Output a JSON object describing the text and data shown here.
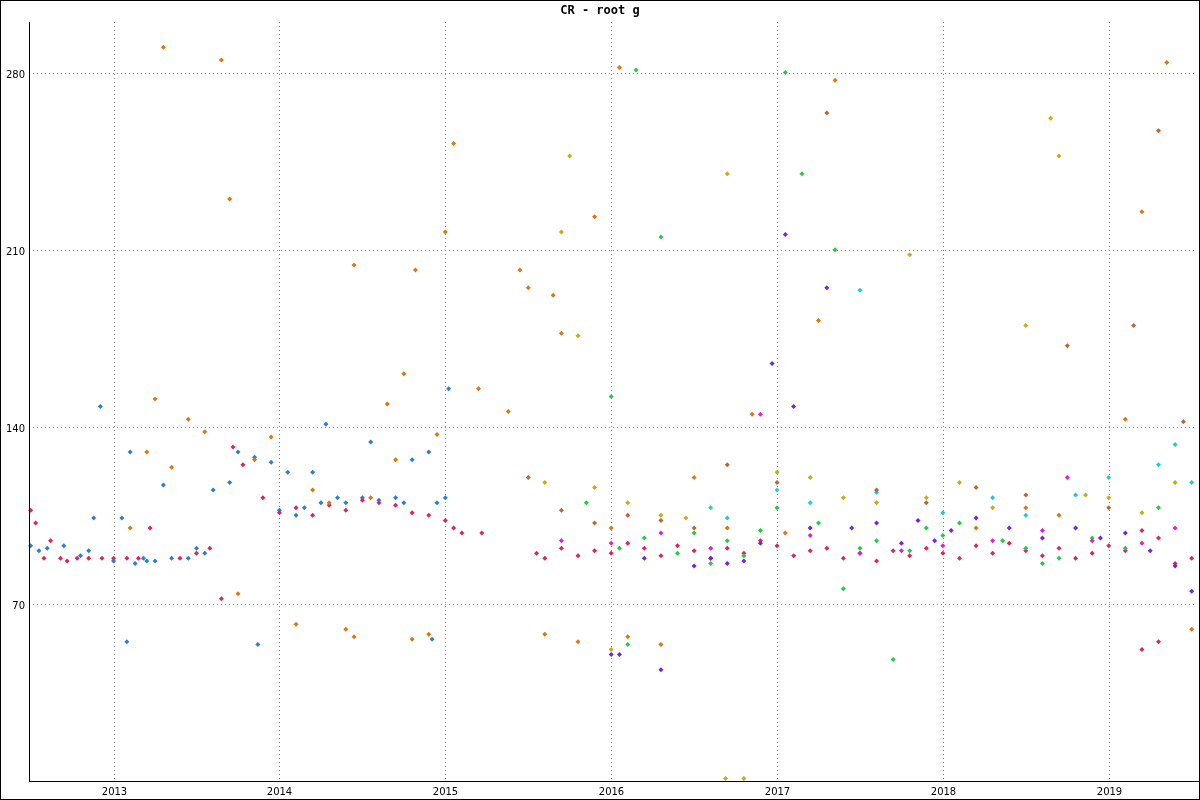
{
  "chart_data": {
    "type": "scatter",
    "title": "CR - root g",
    "grid": true,
    "xlim": [
      2012.49,
      2019.52
    ],
    "ylim": [
      0,
      300
    ],
    "xticks": [
      {
        "value": 2013,
        "label": "2013"
      },
      {
        "value": 2014,
        "label": "2014"
      },
      {
        "value": 2015,
        "label": "2015"
      },
      {
        "value": 2016,
        "label": "2016"
      },
      {
        "value": 2017,
        "label": "2017"
      },
      {
        "value": 2018,
        "label": "2018"
      },
      {
        "value": 2019,
        "label": "2019"
      }
    ],
    "yticks": [
      70,
      140,
      210,
      280
    ],
    "series": [
      {
        "color": "#2a7fd4",
        "x": [
          2012.5,
          2012.55,
          2012.6,
          2012.7,
          2012.8,
          2012.85,
          2012.88,
          2012.92,
          2013.0,
          2013.05,
          2013.1,
          2013.13,
          2013.2,
          2013.3,
          2013.08,
          2013.18,
          2013.25,
          2013.35,
          2013.45,
          2013.5,
          2013.55,
          2013.6,
          2013.7,
          2013.75,
          2013.85,
          2013.95,
          2013.87,
          2014.0,
          2014.05,
          2014.1,
          2014.15,
          2014.2,
          2014.25,
          2014.28,
          2014.35,
          2014.4,
          2014.5,
          2014.55,
          2014.6,
          2014.7,
          2014.75,
          2014.8,
          2014.9,
          2014.95,
          2015.0,
          2015.02,
          2014.92
        ],
        "values": [
          93,
          91,
          92,
          93,
          89,
          91,
          104,
          148,
          87,
          104,
          130,
          86,
          87,
          117,
          55,
          88,
          87,
          88,
          88,
          92,
          90,
          115,
          118,
          130,
          128,
          126,
          54,
          107,
          122,
          105,
          108,
          122,
          110,
          141,
          112,
          110,
          112,
          134,
          111,
          112,
          110,
          127,
          130,
          110,
          112,
          155,
          56
        ]
      },
      {
        "color": "#dd2266",
        "x": [
          2012.5,
          2012.53,
          2012.58,
          2012.62,
          2012.68,
          2012.72,
          2012.78,
          2012.85,
          2012.93,
          2013.0,
          2013.08,
          2013.15,
          2013.22,
          2013.4,
          2013.5,
          2013.58,
          2013.65,
          2013.72,
          2013.78,
          2013.9,
          2014.0,
          2014.1,
          2014.2,
          2014.3,
          2014.4,
          2014.5,
          2014.6,
          2014.7,
          2014.8,
          2014.9,
          2015.0,
          2015.05,
          2015.1,
          2015.22,
          2015.55,
          2015.6,
          2015.7,
          2015.8,
          2015.9,
          2016.0,
          2016.1,
          2016.2,
          2016.3,
          2016.4,
          2016.5,
          2016.6,
          2016.7,
          2016.8,
          2016.9,
          2017.0,
          2017.1,
          2017.2,
          2017.3,
          2017.4,
          2017.5,
          2017.6,
          2017.7,
          2017.8,
          2017.9,
          2018.0,
          2018.1,
          2018.2,
          2018.3,
          2018.4,
          2018.5,
          2018.6,
          2018.7,
          2018.8,
          2018.9,
          2019.0,
          2019.1,
          2019.2,
          2019.3,
          2019.4,
          2019.5,
          2019.2,
          2019.3
        ],
        "values": [
          107,
          102,
          88,
          95,
          88,
          87,
          88,
          88,
          88,
          88,
          88,
          88,
          100,
          88,
          90,
          92,
          72,
          132,
          125,
          112,
          106,
          108,
          105,
          109,
          107,
          111,
          110,
          109,
          106,
          105,
          103,
          100,
          98,
          98,
          90,
          88,
          92,
          89,
          91,
          90,
          94,
          92,
          89,
          93,
          91,
          88,
          92,
          90,
          95,
          93,
          89,
          91,
          92,
          88,
          90,
          87,
          91,
          89,
          92,
          90,
          88,
          93,
          90,
          94,
          91,
          89,
          92,
          88,
          90,
          93,
          91,
          99,
          96,
          86,
          88,
          52,
          55
        ]
      },
      {
        "color": "#dd7711",
        "x": [
          2013.1,
          2013.2,
          2013.25,
          2013.3,
          2013.35,
          2013.45,
          2013.55,
          2013.65,
          2013.7,
          2013.75,
          2013.85,
          2013.95,
          2014.1,
          2014.2,
          2014.3,
          2014.4,
          2014.45,
          2014.45,
          2014.55,
          2014.65,
          2014.7,
          2014.75,
          2014.8,
          2014.82,
          2014.9,
          2014.95,
          2015.0,
          2015.05,
          2015.2,
          2015.38,
          2015.45,
          2015.5,
          2015.6,
          2015.65,
          2015.7,
          2015.8,
          2015.9,
          2016.0,
          2016.05,
          2016.1,
          2016.3,
          2016.5,
          2016.7,
          2016.85,
          2017.05,
          2017.25,
          2017.35,
          2018.2,
          2018.5,
          2018.7,
          2019.1,
          2019.2,
          2019.35,
          2019.5
        ],
        "values": [
          100,
          130,
          151,
          290,
          124,
          143,
          138,
          285,
          230,
          74,
          127,
          136,
          62,
          115,
          110,
          60,
          57,
          204,
          112,
          149,
          127,
          161,
          56,
          202,
          58,
          137,
          217,
          252,
          155,
          146,
          202,
          195,
          58,
          192,
          177,
          55,
          223,
          100,
          282,
          57,
          54,
          120,
          100,
          145,
          98,
          182,
          277,
          100,
          108,
          105,
          143,
          225,
          284,
          60
        ]
      },
      {
        "color": "#22cc44",
        "x": [
          2015.85,
          2016.0,
          2016.05,
          2016.1,
          2016.15,
          2016.2,
          2016.3,
          2016.4,
          2016.5,
          2016.6,
          2016.7,
          2016.8,
          2016.9,
          2017.0,
          2017.05,
          2017.15,
          2017.25,
          2017.35,
          2017.4,
          2017.5,
          2017.6,
          2017.7,
          2017.8,
          2017.9,
          2018.0,
          2018.1,
          2018.36,
          2018.5,
          2018.6,
          2018.7,
          2018.9,
          2019.1,
          2019.3
        ],
        "values": [
          110,
          152,
          92,
          54,
          281,
          96,
          215,
          90,
          98,
          86,
          95,
          89,
          99,
          108,
          280,
          240,
          102,
          210,
          76,
          92,
          95,
          48,
          91,
          100,
          97,
          102,
          95,
          92,
          86,
          88,
          96,
          92,
          108
        ]
      },
      {
        "color": "#7722dd",
        "x": [
          2016.0,
          2016.05,
          2016.2,
          2016.3,
          2016.5,
          2016.6,
          2016.7,
          2016.8,
          2016.9,
          2016.97,
          2017.05,
          2017.1,
          2017.2,
          2017.3,
          2017.45,
          2017.6,
          2017.75,
          2017.85,
          2017.95,
          2018.05,
          2018.2,
          2018.4,
          2018.6,
          2018.8,
          2018.95,
          2019.1,
          2019.25,
          2019.4,
          2019.5
        ],
        "values": [
          50,
          50,
          88,
          44,
          85,
          88,
          86,
          87,
          94,
          165,
          216,
          148,
          100,
          195,
          100,
          102,
          94,
          103,
          95,
          99,
          104,
          100,
          96,
          100,
          96,
          98,
          91,
          85,
          75
        ]
      },
      {
        "color": "#ccaa11",
        "x": [
          2015.6,
          2015.7,
          2015.75,
          2015.8,
          2015.9,
          2016.0,
          2016.1,
          2016.3,
          2016.45,
          2016.7,
          2016.69,
          2016.8,
          2017.0,
          2017.2,
          2017.4,
          2017.6,
          2017.8,
          2017.9,
          2018.1,
          2018.3,
          2018.5,
          2018.65,
          2018.7,
          2018.86,
          2019.0,
          2019.2,
          2019.4
        ],
        "values": [
          118,
          217,
          247,
          176,
          116,
          52,
          110,
          105,
          104,
          240,
          1,
          0,
          122,
          120,
          112,
          110,
          208,
          112,
          118,
          108,
          180,
          262,
          247,
          113,
          112,
          106,
          118
        ]
      },
      {
        "color": "#dd22cc",
        "x": [
          2015.7,
          2016.0,
          2016.3,
          2016.6,
          2016.9,
          2017.2,
          2017.5,
          2017.75,
          2018.0,
          2018.3,
          2018.6,
          2018.75,
          2018.9,
          2019.2,
          2019.4
        ],
        "values": [
          95,
          94,
          98,
          92,
          145,
          97,
          90,
          91,
          93,
          95,
          99,
          120,
          95,
          94,
          100
        ]
      },
      {
        "color": "#22cccc",
        "x": [
          2016.6,
          2016.7,
          2017.0,
          2017.2,
          2017.5,
          2017.6,
          2018.0,
          2018.3,
          2018.5,
          2018.8,
          2019.0,
          2019.3,
          2019.4,
          2019.5
        ],
        "values": [
          108,
          104,
          115,
          110,
          194,
          114,
          106,
          112,
          105,
          113,
          120,
          125,
          133,
          118
        ]
      },
      {
        "color": "#bb6633",
        "x": [
          2015.5,
          2015.7,
          2015.9,
          2016.1,
          2016.3,
          2016.5,
          2016.7,
          2017.0,
          2017.3,
          2017.6,
          2017.9,
          2018.2,
          2018.5,
          2018.75,
          2019.0,
          2019.15,
          2019.3,
          2019.45
        ],
        "values": [
          120,
          107,
          102,
          105,
          103,
          100,
          125,
          118,
          264,
          115,
          110,
          116,
          113,
          172,
          108,
          180,
          257,
          142
        ]
      }
    ]
  }
}
